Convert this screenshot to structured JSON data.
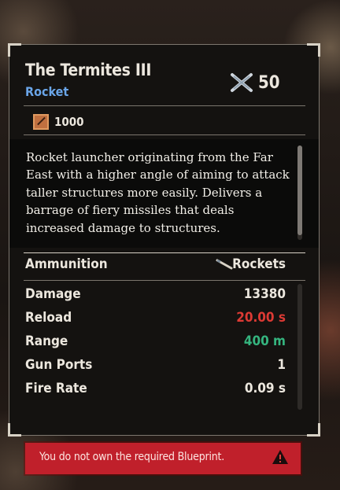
{
  "item": {
    "name": "The Termites III",
    "type": "Rocket",
    "level": "50",
    "price": "1000",
    "description": "Rocket launcher originating from the Far East with a higher angle of aiming to attack taller structures more easily. Delivers a barrage of fiery missiles that deals increased damage to structures."
  },
  "stats": {
    "ammunition_label": "Ammunition",
    "ammunition_value": "Rockets",
    "rows": [
      {
        "label": "Damage",
        "value": "13380",
        "color": "#ece7de"
      },
      {
        "label": "Reload",
        "value": "20.00 s",
        "color": "#dd3a34"
      },
      {
        "label": "Range",
        "value": "400 m",
        "color": "#35b57f"
      },
      {
        "label": "Gun Ports",
        "value": "1",
        "color": "#ece7de"
      },
      {
        "label": "Fire Rate",
        "value": "0.09 s",
        "color": "#ece7de"
      }
    ]
  },
  "warning": {
    "text": "You do not own the required Blueprint."
  },
  "colors": {
    "subtitle": "#6aa5e8",
    "warning_bg": "#c0202b",
    "negative": "#dd3a34",
    "positive": "#35b57f"
  }
}
